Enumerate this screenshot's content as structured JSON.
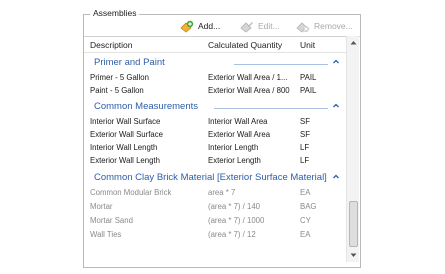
{
  "panel": {
    "title": "Assemblies"
  },
  "toolbar": {
    "add_label": "Add...",
    "edit_label": "Edit...",
    "remove_label": "Remove..."
  },
  "columns": {
    "description": "Description",
    "quantity": "Calculated Quantity",
    "unit": "Unit"
  },
  "groups": [
    {
      "title": "Primer and Paint",
      "rows": [
        {
          "description": "Primer - 5 Gallon",
          "quantity": "Exterior Wall Area / 1...",
          "unit": "PAIL"
        },
        {
          "description": "Paint - 5 Gallon",
          "quantity": "Exterior Wall Area / 800",
          "unit": "PAIL"
        }
      ]
    },
    {
      "title": "Common Measurements",
      "rows": [
        {
          "description": "Interior Wall Surface",
          "quantity": "Interior Wall Area",
          "unit": "SF"
        },
        {
          "description": "Exterior Wall Surface",
          "quantity": "Exterior Wall Area",
          "unit": "SF"
        },
        {
          "description": "Interior Wall Length",
          "quantity": "Interior Length",
          "unit": "LF"
        },
        {
          "description": "Exterior Wall Length",
          "quantity": "Exterior Length",
          "unit": "LF"
        }
      ]
    },
    {
      "title": "Common Clay Brick Material [Exterior Surface Material]",
      "rows": [
        {
          "description": "Common Modular Brick",
          "quantity": "area * 7",
          "unit": "EA"
        },
        {
          "description": "Mortar",
          "quantity": "(area * 7) / 140",
          "unit": "BAG"
        },
        {
          "description": "Mortar Sand",
          "quantity": "(area * 7) / 1000",
          "unit": "CY"
        },
        {
          "description": "Wall Ties",
          "quantity": "(area * 7) / 12",
          "unit": "EA"
        }
      ]
    }
  ],
  "colors": {
    "group_title": "#2d5da8",
    "group_line": "#a9c1e4",
    "dim_text": "#8a8a8a"
  },
  "icons": [
    "add-icon",
    "edit-icon",
    "remove-icon",
    "collapse-chevron-icon",
    "scroll-up-icon",
    "scroll-down-icon"
  ]
}
